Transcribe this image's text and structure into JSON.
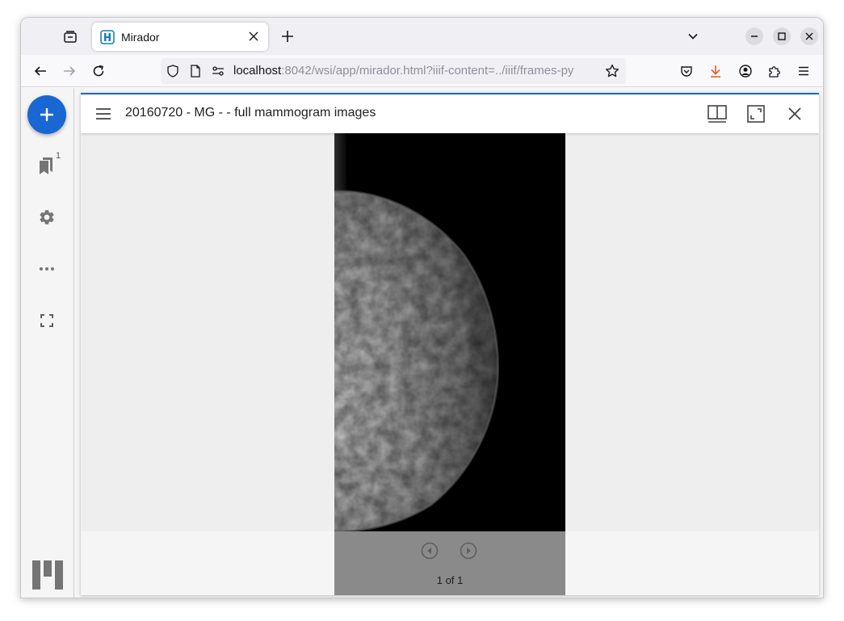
{
  "browser": {
    "tab_title": "Mirador",
    "url_host": "localhost",
    "url_rest": ":8042/wsi/app/mirador.html?iiif-content=../iiif/frames-py"
  },
  "mirador": {
    "bookmarks_badge": "1",
    "viewer_title": "20160720 - MG - - full mammogram images",
    "page_count": "1 of 1"
  },
  "icons": {
    "tab_overview": "tab-overview-icon",
    "favicon": "mirador-favicon-icon",
    "close_tab": "close-icon",
    "new_tab": "plus-icon",
    "tab_list": "chevron-down-icon",
    "minimize": "minimize-icon",
    "maximize": "maximize-icon",
    "close_window": "close-icon",
    "back": "arrow-left-icon",
    "forward": "arrow-right-icon",
    "reload": "reload-icon",
    "shield": "shield-icon",
    "page": "page-icon",
    "permissions": "permissions-icon",
    "bookmark_star": "star-icon",
    "pocket": "pocket-icon",
    "downloads": "download-icon",
    "account": "account-icon",
    "extensions": "puzzle-icon",
    "app_menu": "hamburger-icon",
    "add_resource": "plus-icon",
    "bookmarks": "bookmarks-icon",
    "settings": "gear-icon",
    "more": "more-horizontal-icon",
    "fullscreen": "fullscreen-icon",
    "window_menu": "hamburger-icon",
    "view_type": "book-view-icon",
    "maximize_window": "maximize-window-icon",
    "close_viewer": "close-icon",
    "previous_page": "previous-icon",
    "next_page": "next-icon"
  },
  "colors": {
    "accent": "#1967d2",
    "download_accent": "#e25920"
  }
}
